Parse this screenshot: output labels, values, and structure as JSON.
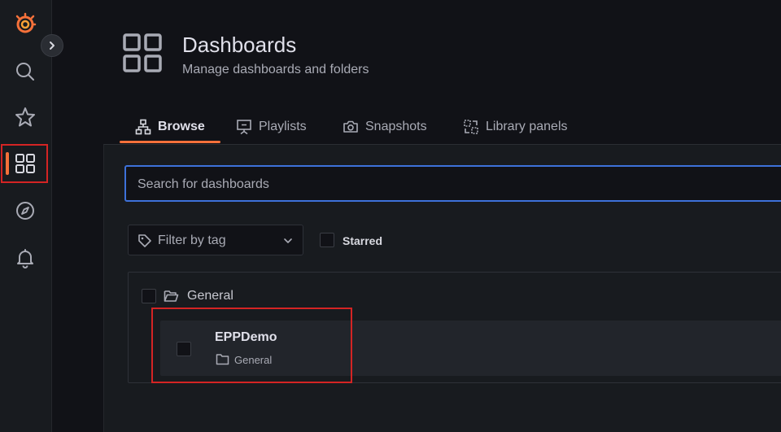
{
  "header": {
    "title": "Dashboards",
    "subtitle": "Manage dashboards and folders"
  },
  "tabs": [
    {
      "label": "Browse",
      "icon": "sitemap-icon",
      "active": true
    },
    {
      "label": "Playlists",
      "icon": "presentation-icon",
      "active": false
    },
    {
      "label": "Snapshots",
      "icon": "camera-icon",
      "active": false
    },
    {
      "label": "Library panels",
      "icon": "library-panel-icon",
      "active": false
    }
  ],
  "sidebar": {
    "items": [
      {
        "icon": "grafana-logo-icon"
      },
      {
        "icon": "search-icon"
      },
      {
        "icon": "star-icon"
      },
      {
        "icon": "dashboards-icon",
        "active": true
      },
      {
        "icon": "compass-icon"
      },
      {
        "icon": "bell-icon"
      }
    ]
  },
  "search": {
    "placeholder": "Search for dashboards",
    "value": ""
  },
  "filters": {
    "tag_placeholder": "Filter by tag",
    "starred_label": "Starred"
  },
  "results": {
    "folder": {
      "name": "General"
    },
    "dashboards": [
      {
        "title": "EPPDemo",
        "folder": "General"
      }
    ]
  },
  "colors": {
    "accent": "#f5713a",
    "focus_border": "#3d71d9",
    "highlight_box": "#d42424",
    "background": "#111217",
    "panel": "#181b1f"
  }
}
